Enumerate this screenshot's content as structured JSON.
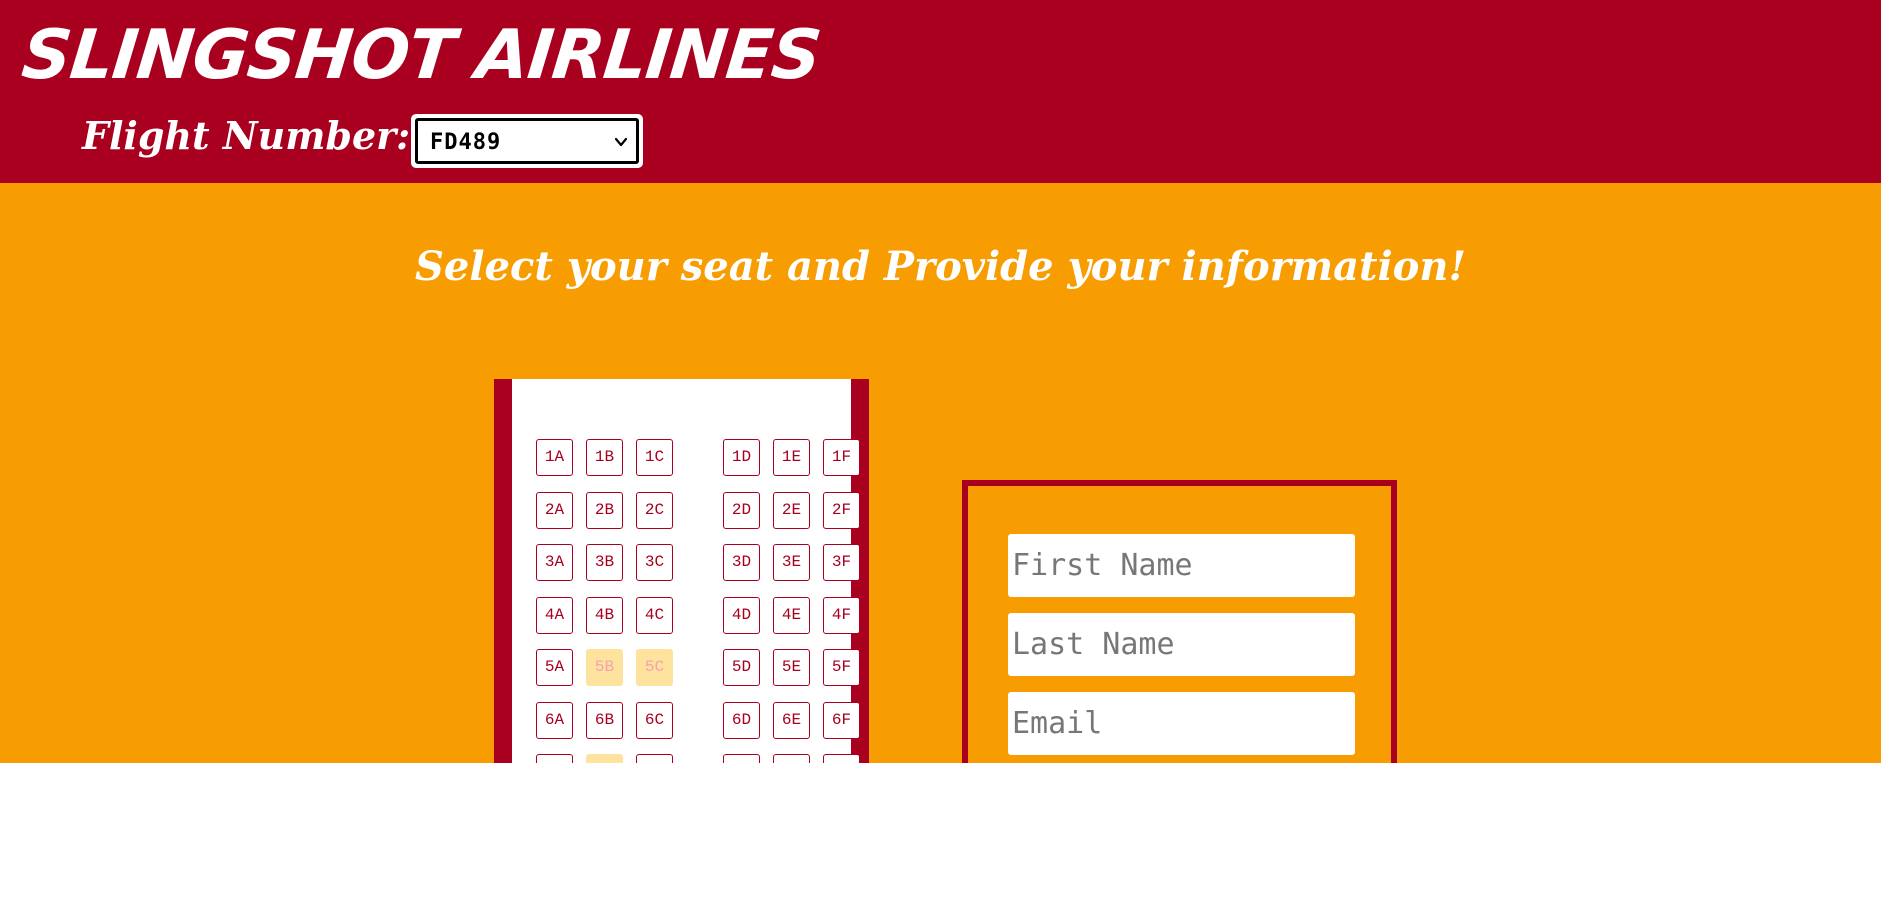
{
  "header": {
    "brand": "SLINGSHOT AIRLINES",
    "flight_label": "Flight Number:",
    "flight_select": {
      "value": "FD489"
    }
  },
  "main": {
    "heading": "Select your seat and Provide your information!"
  },
  "seat_map": {
    "rows": [
      {
        "seats": [
          {
            "label": "1A",
            "taken": false
          },
          {
            "label": "1B",
            "taken": false
          },
          {
            "label": "1C",
            "taken": false
          },
          {
            "label": "1D",
            "taken": false
          },
          {
            "label": "1E",
            "taken": false
          },
          {
            "label": "1F",
            "taken": false
          }
        ]
      },
      {
        "seats": [
          {
            "label": "2A",
            "taken": false
          },
          {
            "label": "2B",
            "taken": false
          },
          {
            "label": "2C",
            "taken": false
          },
          {
            "label": "2D",
            "taken": false
          },
          {
            "label": "2E",
            "taken": false
          },
          {
            "label": "2F",
            "taken": false
          }
        ]
      },
      {
        "seats": [
          {
            "label": "3A",
            "taken": false
          },
          {
            "label": "3B",
            "taken": false
          },
          {
            "label": "3C",
            "taken": false
          },
          {
            "label": "3D",
            "taken": false
          },
          {
            "label": "3E",
            "taken": false
          },
          {
            "label": "3F",
            "taken": false
          }
        ]
      },
      {
        "seats": [
          {
            "label": "4A",
            "taken": false
          },
          {
            "label": "4B",
            "taken": false
          },
          {
            "label": "4C",
            "taken": false
          },
          {
            "label": "4D",
            "taken": false
          },
          {
            "label": "4E",
            "taken": false
          },
          {
            "label": "4F",
            "taken": false
          }
        ]
      },
      {
        "seats": [
          {
            "label": "5A",
            "taken": false
          },
          {
            "label": "5B",
            "taken": true
          },
          {
            "label": "5C",
            "taken": true
          },
          {
            "label": "5D",
            "taken": false
          },
          {
            "label": "5E",
            "taken": false
          },
          {
            "label": "5F",
            "taken": false
          }
        ]
      },
      {
        "seats": [
          {
            "label": "6A",
            "taken": false
          },
          {
            "label": "6B",
            "taken": false
          },
          {
            "label": "6C",
            "taken": false
          },
          {
            "label": "6D",
            "taken": false
          },
          {
            "label": "6E",
            "taken": false
          },
          {
            "label": "6F",
            "taken": false
          }
        ]
      },
      {
        "seats": [
          {
            "label": "",
            "taken": false
          },
          {
            "label": "",
            "taken": true
          },
          {
            "label": "",
            "taken": false
          },
          {
            "label": "",
            "taken": false
          },
          {
            "label": "",
            "taken": false
          },
          {
            "label": "",
            "taken": false
          }
        ]
      }
    ]
  },
  "form": {
    "first_name": {
      "placeholder": "First Name",
      "value": ""
    },
    "last_name": {
      "placeholder": "Last Name",
      "value": ""
    },
    "email": {
      "placeholder": "Email",
      "value": ""
    }
  },
  "colors": {
    "brand_red": "#a9001f",
    "background_orange": "#f79c01",
    "seat_taken": "#fde39e"
  },
  "icons": {
    "select_arrow": "chevron-down-icon"
  }
}
